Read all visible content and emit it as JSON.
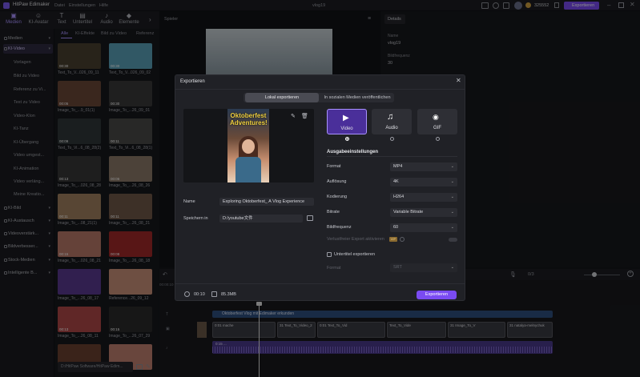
{
  "titlebar": {
    "app_name": "HitPaw Edimaker",
    "menu": [
      "Datei",
      "Einstellungen",
      "Hilfe"
    ],
    "document": "vlog19",
    "credits": "325552",
    "export_label": "Exportieren"
  },
  "toolbar": {
    "tabs": [
      "Medien",
      "KI-Avatar",
      "Text",
      "Untertitel",
      "Audio",
      "Elemente"
    ]
  },
  "sidebar": {
    "items": [
      {
        "label": "Medien",
        "sub": false
      },
      {
        "label": "KI-Video",
        "sub": false,
        "active": true
      },
      {
        "label": "Vorlagen",
        "sub": true
      },
      {
        "label": "Bild zu Video",
        "sub": true
      },
      {
        "label": "Referenz zu Vi...",
        "sub": true
      },
      {
        "label": "Text zu Video",
        "sub": true
      },
      {
        "label": "Video-Klon",
        "sub": true
      },
      {
        "label": "KI-Tanz",
        "sub": true
      },
      {
        "label": "KI-Übergang",
        "sub": true
      },
      {
        "label": "Video umgest...",
        "sub": true
      },
      {
        "label": "KI-Animation",
        "sub": true
      },
      {
        "label": "Video verläng...",
        "sub": true
      },
      {
        "label": "Meine Kreatio...",
        "sub": true
      },
      {
        "label": "KI-Bild",
        "sub": false
      },
      {
        "label": "KI-Austausch",
        "sub": false
      },
      {
        "label": "Videoverstärk...",
        "sub": false
      },
      {
        "label": "Bildverbesser...",
        "sub": false
      },
      {
        "label": "Stock-Medien",
        "sub": false
      },
      {
        "label": "Intelligente B...",
        "sub": false
      }
    ]
  },
  "media": {
    "tabs": [
      "Alle",
      "KI-Effekte",
      "Bild zu Video",
      "Referenz"
    ],
    "items": [
      {
        "caption": "Text_To_V...026_09_11",
        "dur": "00:30",
        "color": "#4a4030"
      },
      {
        "caption": "Text_To_V...026_09_02",
        "dur": "00:30",
        "color": "#5aa0b8"
      },
      {
        "caption": "Image_To_...9_01(1)",
        "dur": "00:05",
        "color": "#6a4838"
      },
      {
        "caption": "Image_To_...26_09_01",
        "dur": "00:30",
        "color": "#3a3a3a"
      },
      {
        "caption": "Text_To_Vi...6_08_28(2)",
        "dur": "00:09",
        "color": "#30383a"
      },
      {
        "caption": "Text_To_Vi...6_08_28(1)",
        "dur": "00:11",
        "color": "#4a4a48"
      },
      {
        "caption": "Image_To_...026_08_28",
        "dur": "00:13",
        "color": "#383838"
      },
      {
        "caption": "Image_To_...26_08_26",
        "dur": "00:06",
        "color": "#8a7868"
      },
      {
        "caption": "Image_To_...08_21(1)",
        "dur": "00:11",
        "color": "#a08060"
      },
      {
        "caption": "Image_To_...26_08_21",
        "dur": "00:11",
        "color": "#705848"
      },
      {
        "caption": "Image_To_...026_08_21",
        "dur": "00:15",
        "color": "#b87868"
      },
      {
        "caption": "Image_To_...26_08_18",
        "dur": "00:08",
        "color": "#a02828"
      },
      {
        "caption": "Image_To_...26_08_17",
        "dur": "",
        "color": "#5a3a90"
      },
      {
        "caption": "Reference...26_09_12",
        "dur": "",
        "color": "#c89078"
      },
      {
        "caption": "Image_To_...26_08_11",
        "dur": "00:13",
        "color": "#b04848"
      },
      {
        "caption": "Image_To_...26_07_29",
        "dur": "00:15",
        "color": "#2a2a2a"
      },
      {
        "caption": "",
        "dur": "",
        "color": "#6a4030"
      },
      {
        "caption": "",
        "dur": "",
        "color": "#c08070"
      }
    ],
    "path": "D:/HitPaw Software/HitPaw Edim..."
  },
  "player": {
    "label": "Spieler"
  },
  "details": {
    "tab": "Details",
    "name_label": "Name",
    "name_value": "vlog19",
    "fps_label": "Bildfrequenz",
    "fps_value": "30"
  },
  "dialog": {
    "title": "Exportieren",
    "seg_local": "Lokal exportieren",
    "seg_social": "In sozialen Medien veröffentlichen",
    "preview_title": "Oktoberfest Adventures!",
    "name_label": "Name",
    "name_value": "Exploring Oktoberfest_ A Vlog Experience",
    "save_label": "Speichern in",
    "save_value": "D:/youtube文件",
    "formats": [
      "Video",
      "Audio",
      "GIF"
    ],
    "settings_title": "Ausgabeeinstellungen",
    "rows": [
      {
        "label": "Format",
        "value": "MP4"
      },
      {
        "label": "Auflösung",
        "value": "4K"
      },
      {
        "label": "Kodierung",
        "value": "H264"
      },
      {
        "label": "Bitrate",
        "value": "Variable Bitrate"
      },
      {
        "label": "Bildfrequenz",
        "value": "60"
      }
    ],
    "accel_label": "Verlustfreier Export aktivieren",
    "accel_badge": "VIP",
    "subtitle_label": "Untertitel exportieren",
    "subtitle_format_label": "Format",
    "subtitle_format_value": "SRT",
    "duration": "00:10",
    "size": "85.3MB",
    "export_button": "Exportieren"
  },
  "timeline": {
    "time_start": "00:00:10",
    "text_track": "Oktoberfest Vlog mit Edimaker erkunden",
    "clips": [
      "0:01 mache",
      "31 Text_To_Video_2",
      "0:01 Text_To_Vid",
      "Text_To_Vide",
      "31 Image_To_V",
      "31 natalya-melnychuk"
    ],
    "audio": "0:15 ...",
    "zoom": "0/3"
  },
  "colors": {
    "accent": "#7a4bf2",
    "accent_light": "#a992ff"
  }
}
